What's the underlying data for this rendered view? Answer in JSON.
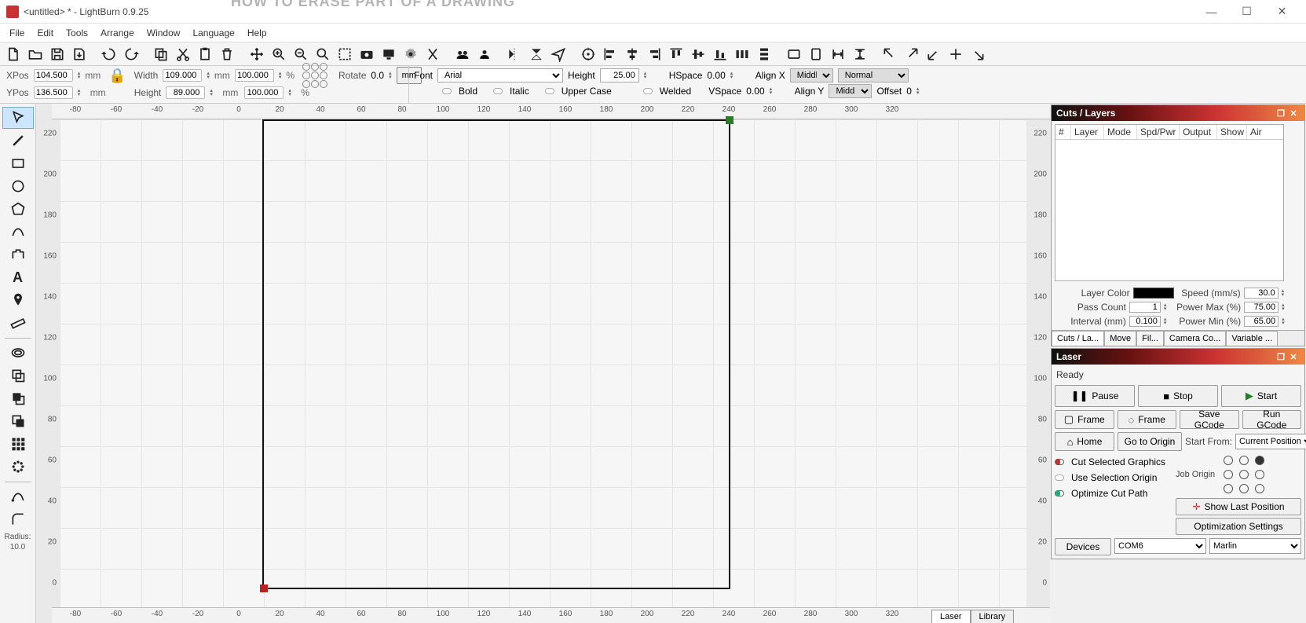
{
  "window": {
    "title": "<untitled> * - LightBurn 0.9.25"
  },
  "menu": [
    "File",
    "Edit",
    "Tools",
    "Arrange",
    "Window",
    "Language",
    "Help"
  ],
  "pos": {
    "xpos_label": "XPos",
    "xpos": "104.500",
    "xpos_unit": "mm",
    "ypos_label": "YPos",
    "ypos": "136.500",
    "ypos_unit": "mm",
    "width_label": "Width",
    "width": "109.000",
    "width_unit": "mm",
    "width_pct": "100.000",
    "pct": "%",
    "height_label": "Height",
    "height": "89.000",
    "height_unit": "mm",
    "height_pct": "100.000",
    "rotate_label": "Rotate",
    "rotate": "0.0",
    "mm_btn": "mm"
  },
  "text": {
    "font_label": "Font",
    "font": "Arial",
    "height_label": "Height",
    "height": "25.00",
    "hspace_label": "HSpace",
    "hspace": "0.00",
    "vspace_label": "VSpace",
    "vspace": "0.00",
    "alignx_label": "Align X",
    "alignx": "Middle",
    "aligny_label": "Align Y",
    "aligny": "Middle",
    "mode": "Normal",
    "offset_label": "Offset",
    "offset": "0",
    "bold": "Bold",
    "italic": "Italic",
    "upper": "Upper Case",
    "welded": "Welded"
  },
  "ruler_x": [
    "-80",
    "-60",
    "-40",
    "-20",
    "0",
    "20",
    "40",
    "60",
    "80",
    "100",
    "120",
    "140",
    "160",
    "180",
    "200",
    "220",
    "240",
    "260",
    "280",
    "300",
    "320"
  ],
  "ruler_y": [
    "220",
    "200",
    "180",
    "160",
    "140",
    "120",
    "100",
    "80",
    "60",
    "40",
    "20",
    "0"
  ],
  "left_tools_radius_label": "Radius:",
  "left_tools_radius": "10.0",
  "cuts_panel": {
    "title": "Cuts / Layers",
    "cols": [
      "#",
      "Layer",
      "Mode",
      "Spd/Pwr",
      "Output",
      "Show",
      "Air"
    ],
    "layer_color_label": "Layer Color",
    "speed_label": "Speed (mm/s)",
    "speed": "30.0",
    "pass_label": "Pass Count",
    "pass": "1",
    "pmax_label": "Power Max (%)",
    "pmax": "75.00",
    "interval_label": "Interval (mm)",
    "interval": "0.100",
    "pmin_label": "Power Min (%)",
    "pmin": "65.00",
    "tabs": [
      "Cuts / La...",
      "Move",
      "Fil...",
      "Camera Co...",
      "Variable ..."
    ]
  },
  "laser_panel": {
    "title": "Laser",
    "status": "Ready",
    "pause": "Pause",
    "stop": "Stop",
    "start": "Start",
    "frame1": "Frame",
    "frame2": "Frame",
    "savegcode": "Save GCode",
    "rungcode": "Run GCode",
    "home": "Home",
    "goorigin": "Go to Origin",
    "startfrom_label": "Start From:",
    "startfrom": "Current Position",
    "joborigin_label": "Job Origin",
    "cutsel": "Cut Selected Graphics",
    "useselorigin": "Use Selection Origin",
    "showlast": "Show Last Position",
    "optcut": "Optimize Cut Path",
    "optset": "Optimization Settings",
    "devices": "Devices",
    "port": "COM6",
    "firmware": "Marlin"
  },
  "bottom_tabs": [
    "Laser",
    "Library"
  ],
  "hint": "HOW TO ERASE PART OF A DRAWING"
}
